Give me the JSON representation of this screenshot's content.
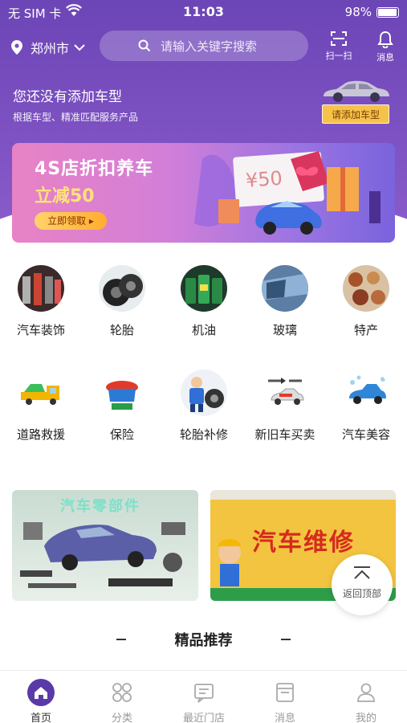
{
  "status_bar": {
    "carrier": "无 SIM 卡",
    "time": "11:03",
    "battery": "98%"
  },
  "header": {
    "city": "郑州市",
    "search_placeholder": "请输入关键字搜索",
    "scan_label": "扫一扫",
    "message_label": "消息"
  },
  "car_prompt": {
    "title": "您还没有添加车型",
    "subtitle": "根据车型、精准匹配服务产品",
    "add_button": "请添加车型"
  },
  "banner": {
    "title": "4S店折扣养车",
    "discount": "立减50",
    "cta": "立即领取 ▸",
    "coupon_value": "¥50"
  },
  "categories_row1": [
    {
      "label": "汽车装饰",
      "icon": "car-decoration-icon"
    },
    {
      "label": "轮胎",
      "icon": "tire-icon"
    },
    {
      "label": "机油",
      "icon": "engine-oil-icon"
    },
    {
      "label": "玻璃",
      "icon": "glass-icon"
    },
    {
      "label": "特产",
      "icon": "local-specialty-icon"
    }
  ],
  "categories_row2": [
    {
      "label": "道路救援",
      "icon": "tow-truck-icon"
    },
    {
      "label": "保险",
      "icon": "insurance-icon"
    },
    {
      "label": "轮胎补修",
      "icon": "tire-repair-icon"
    },
    {
      "label": "新旧车买卖",
      "icon": "car-trade-icon"
    },
    {
      "label": "汽车美容",
      "icon": "car-wash-icon"
    }
  ],
  "promos": {
    "parts_title": "汽车零部件",
    "repair_title": "汽车维修"
  },
  "back_to_top": "返回顶部",
  "section_title": "精品推荐",
  "tabbar": [
    {
      "label": "首页",
      "icon": "home-icon",
      "active": true
    },
    {
      "label": "分类",
      "icon": "category-icon",
      "active": false
    },
    {
      "label": "最近门店",
      "icon": "store-icon",
      "active": false
    },
    {
      "label": "消息",
      "icon": "message-icon",
      "active": false
    },
    {
      "label": "我的",
      "icon": "profile-icon",
      "active": false
    }
  ],
  "colors": {
    "brand": "#7a4fc0",
    "accent": "#f5c24b",
    "active_tab": "#5a3aa8"
  }
}
